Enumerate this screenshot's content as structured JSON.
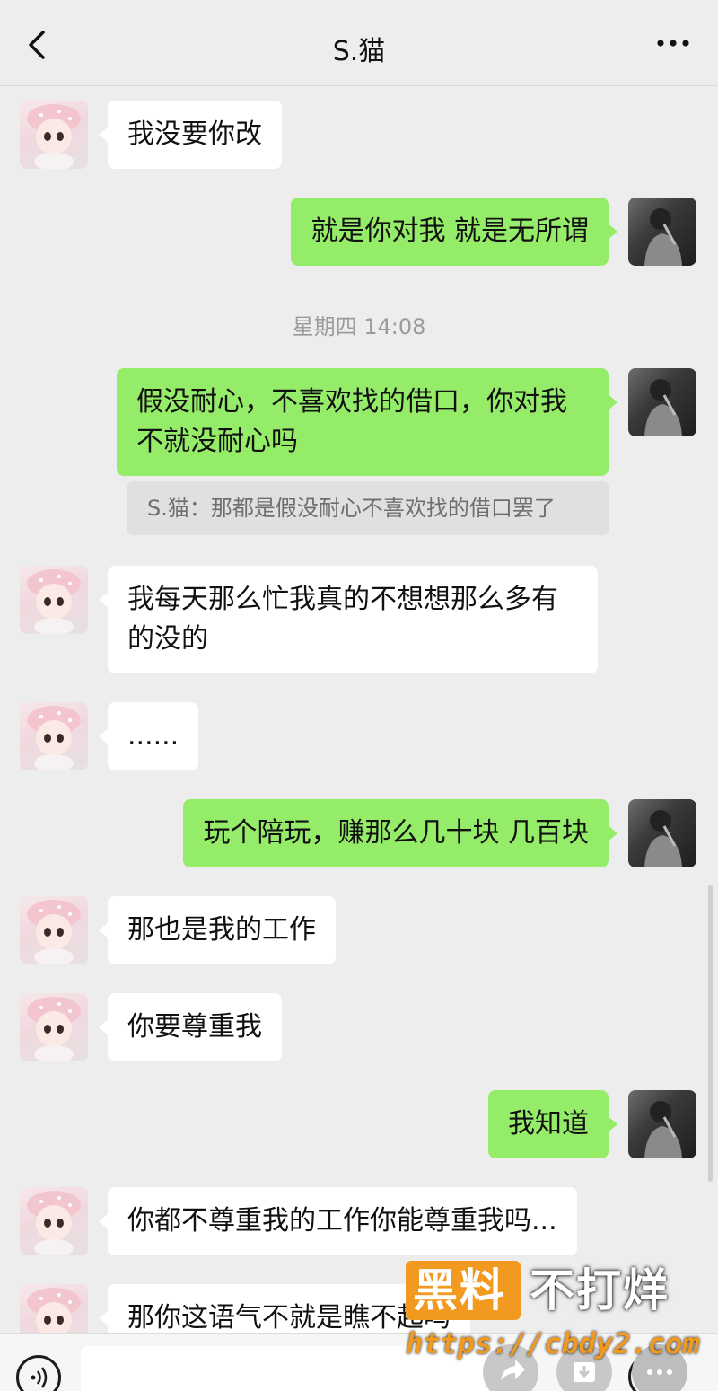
{
  "header": {
    "back_icon": "chevron-left-icon",
    "title": "S.猫",
    "more_icon": "ellipsis-icon"
  },
  "messages": [
    {
      "from": "her",
      "text": "我没要你改"
    },
    {
      "from": "me",
      "text": "就是你对我 就是无所谓"
    },
    {
      "type": "timestamp",
      "text": "星期四 14:08"
    },
    {
      "from": "me",
      "text": "假没耐心，不喜欢找的借口，你对我不就没耐心吗"
    },
    {
      "type": "quote",
      "text": "S.猫：那都是假没耐心不喜欢找的借口罢了"
    },
    {
      "from": "her",
      "text": "我每天那么忙我真的不想想那么多有的没的"
    },
    {
      "from": "her",
      "text": "......"
    },
    {
      "from": "me",
      "text": "玩个陪玩，赚那么几十块 几百块"
    },
    {
      "from": "her",
      "text": "那也是我的工作"
    },
    {
      "from": "her",
      "text": "你要尊重我"
    },
    {
      "from": "me",
      "text": "我知道"
    },
    {
      "from": "her",
      "text": "你都不尊重我的工作你能尊重我吗..."
    },
    {
      "from": "her",
      "text": "那你这语气不就是瞧不起吗"
    }
  ],
  "input_bar": {
    "voice_icon": "voice-icon",
    "forward_icon": "forward-icon",
    "download_icon": "download-icon",
    "emoji_icon": "emoji-icon",
    "more_icon": "more-options-icon"
  },
  "watermark": {
    "brand": "黑料",
    "slogan": "不打烊",
    "url": "https://cbdy2.com",
    "color": "#f29a1f"
  },
  "colors": {
    "outgoing_bubble": "#95ec69",
    "incoming_bubble": "#ffffff",
    "background": "#ededed"
  }
}
